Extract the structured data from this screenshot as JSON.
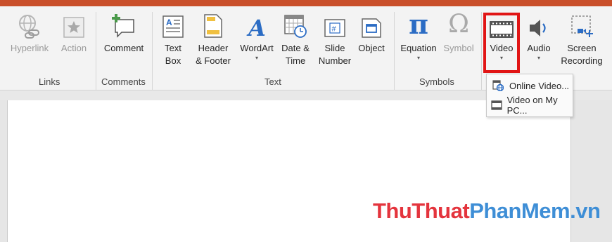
{
  "ribbon": {
    "links_group": {
      "label": "Links",
      "hyperlink": "Hyperlink",
      "action": "Action"
    },
    "comments_group": {
      "label": "Comments",
      "comment": "Comment"
    },
    "text_group": {
      "label": "Text",
      "text_box_line1": "Text",
      "text_box_line2": "Box",
      "header_line1": "Header",
      "header_line2": "& Footer",
      "wordart": "WordArt",
      "date_line1": "Date &",
      "date_line2": "Time",
      "slide_line1": "Slide",
      "slide_line2": "Number",
      "object": "Object",
      "caret": "▾"
    },
    "symbols_group": {
      "label": "Symbols",
      "equation": "Equation",
      "symbol": "Symbol",
      "pi_glyph": "π",
      "omega_glyph": "Ω",
      "caret": "▾"
    },
    "media_group": {
      "video": "Video",
      "audio": "Audio",
      "screen_line1": "Screen",
      "screen_line2": "Recording",
      "caret": "▾"
    }
  },
  "video_menu": {
    "online_video": "Online Video...",
    "video_on_pc": "Video on My PC..."
  },
  "watermark": {
    "part1": "ThuThuat",
    "part2": "PhanMem",
    "part3": ".vn"
  },
  "colors": {
    "highlight": "#e11515",
    "title_bar": "#c94f2a",
    "accent_blue": "#2b6cc4"
  }
}
